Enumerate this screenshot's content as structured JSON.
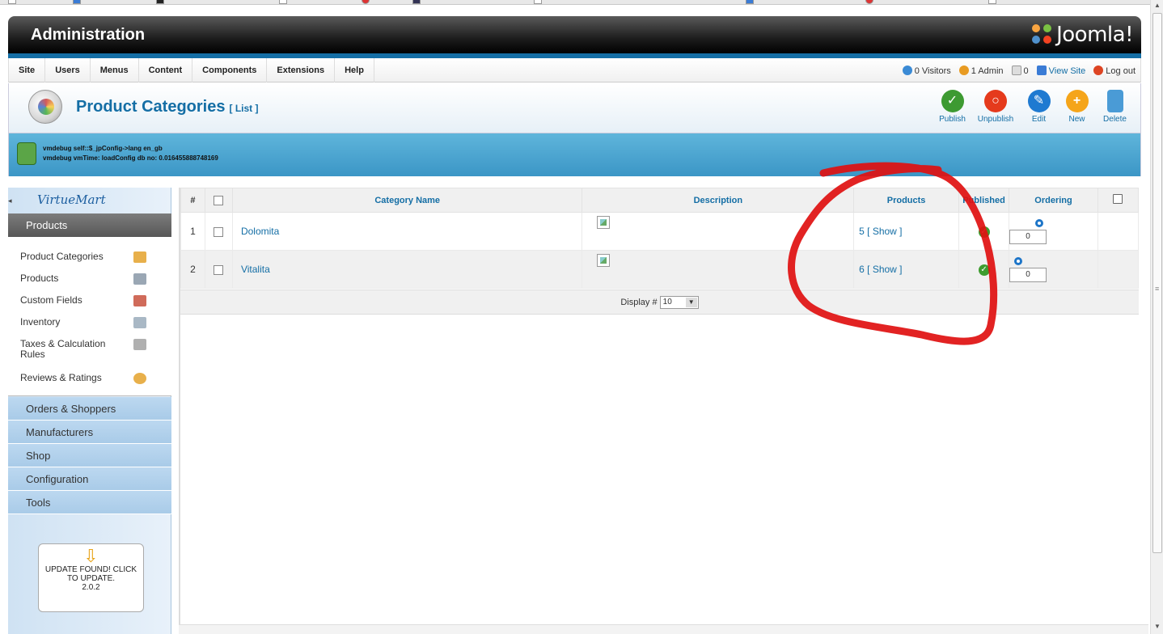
{
  "header": {
    "title": "Administration",
    "logo_text": "Joomla!"
  },
  "menubar": {
    "items": [
      "Site",
      "Users",
      "Menus",
      "Content",
      "Components",
      "Extensions",
      "Help"
    ]
  },
  "status": {
    "visitors": "0 Visitors",
    "admins": "1 Admin",
    "messages": "0",
    "view_site": "View Site",
    "logout": "Log out"
  },
  "page": {
    "title": "Product Categories",
    "subtitle": "[ List ]"
  },
  "toolbar": {
    "publish": "Publish",
    "unpublish": "Unpublish",
    "edit": "Edit",
    "new": "New",
    "delete": "Delete"
  },
  "debug": {
    "line1": "vmdebug self::$_jpConfig->lang en_gb",
    "line2": "vmdebug vmTime: loadConfig db no: 0.016455888748169"
  },
  "sidebar": {
    "logo": "VirtueMart",
    "active_section": "Products",
    "items": [
      {
        "label": "Product Categories",
        "icon": "folder-icon",
        "color": "#e8b04b"
      },
      {
        "label": "Products",
        "icon": "box-icon",
        "color": "#9aa7b4"
      },
      {
        "label": "Custom Fields",
        "icon": "tag-icon",
        "color": "#d06b5a"
      },
      {
        "label": "Inventory",
        "icon": "clipboard-icon",
        "color": "#a9b8c5"
      },
      {
        "label": "Taxes & Calculation Rules",
        "icon": "calculator-icon",
        "color": "#b0b0b0"
      },
      {
        "label": "Reviews & Ratings",
        "icon": "speech-bubble-icon",
        "color": "#e8b04b"
      }
    ],
    "sections": [
      "Orders & Shoppers",
      "Manufacturers",
      "Shop",
      "Configuration",
      "Tools"
    ],
    "update": {
      "line1": "UPDATE FOUND! CLICK",
      "line2": "TO UPDATE.",
      "version": "2.0.2"
    }
  },
  "table": {
    "headers": {
      "num": "#",
      "name": "Category Name",
      "description": "Description",
      "products": "Products",
      "published": "Published",
      "ordering": "Ordering"
    },
    "rows": [
      {
        "num": "1",
        "name": "Dolomita",
        "products": "5 [ Show ]",
        "published": true,
        "ordering": "0"
      },
      {
        "num": "2",
        "name": "Vitalita",
        "products": "6 [ Show ]",
        "published": true,
        "ordering": "0"
      }
    ],
    "display_label": "Display #",
    "display_value": "10"
  },
  "colors": {
    "accent": "#146ea5",
    "annotation": "#e01010"
  }
}
